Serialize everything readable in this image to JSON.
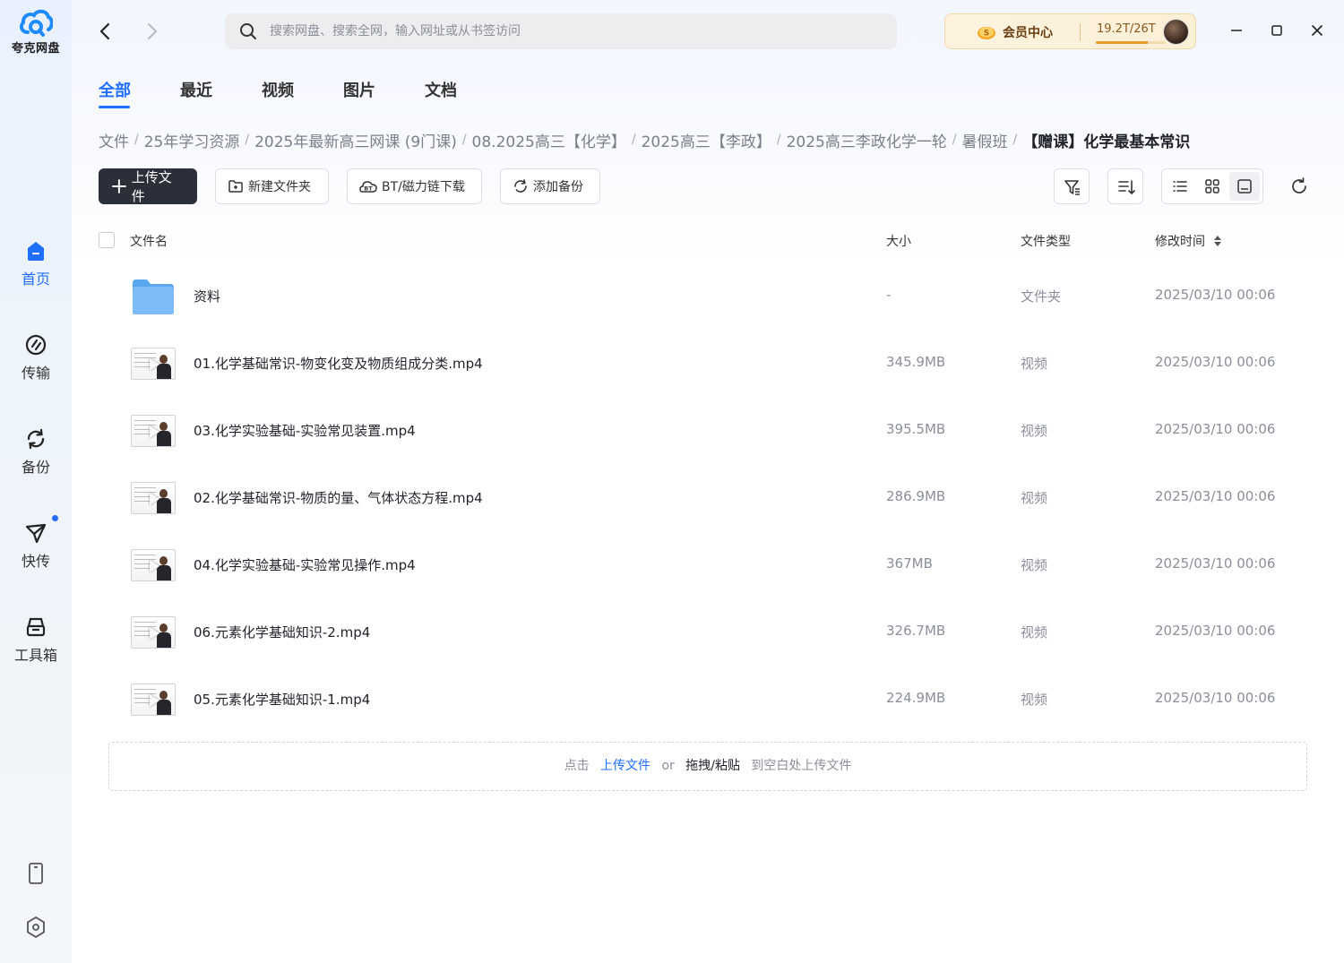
{
  "app": {
    "logo_text": "夸克网盘"
  },
  "sidebar": {
    "items": [
      {
        "label": "首页",
        "icon": "home-icon",
        "active": true
      },
      {
        "label": "传输",
        "icon": "transfer-icon",
        "active": false
      },
      {
        "label": "备份",
        "icon": "backup-icon",
        "active": false
      },
      {
        "label": "快传",
        "icon": "quick-send-icon",
        "active": false,
        "has_dot": true
      },
      {
        "label": "工具箱",
        "icon": "toolbox-icon",
        "active": false
      }
    ],
    "bottom_icons": [
      "phone-icon",
      "settings-icon"
    ]
  },
  "topbar": {
    "search_placeholder": "搜索网盘、搜索全网，输入网址或从书签访问",
    "vip_label": "会员中心",
    "storage_text": "19.2T/26T",
    "storage_used_fraction": 0.738
  },
  "tabs": [
    {
      "label": "全部",
      "active": true
    },
    {
      "label": "最近",
      "active": false
    },
    {
      "label": "视频",
      "active": false
    },
    {
      "label": "图片",
      "active": false
    },
    {
      "label": "文档",
      "active": false
    }
  ],
  "breadcrumb": [
    "文件",
    "25年学习资源",
    "2025年最新高三网课 (9门课)",
    "08.2025高三【化学】",
    "2025高三【李政】",
    "2025高三李政化学一轮",
    "暑假班",
    "【赠课】化学最基本常识"
  ],
  "toolbar": {
    "upload_label": "上传文件",
    "new_folder_label": "新建文件夹",
    "bt_label": "BT/磁力链下载",
    "backup_label": "添加备份"
  },
  "columns": {
    "name": "文件名",
    "size": "大小",
    "type": "文件类型",
    "modified": "修改时间"
  },
  "files": [
    {
      "name": "资料",
      "size": "-",
      "type": "文件夹",
      "modified": "2025/03/10 00:06",
      "kind": "folder"
    },
    {
      "name": "01.化学基础常识-物变化变及物质组成分类.mp4",
      "size": "345.9MB",
      "type": "视频",
      "modified": "2025/03/10 00:06",
      "kind": "video"
    },
    {
      "name": "03.化学实验基础-实验常见装置.mp4",
      "size": "395.5MB",
      "type": "视频",
      "modified": "2025/03/10 00:06",
      "kind": "video"
    },
    {
      "name": "02.化学基础常识-物质的量、气体状态方程.mp4",
      "size": "286.9MB",
      "type": "视频",
      "modified": "2025/03/10 00:06",
      "kind": "video"
    },
    {
      "name": "04.化学实验基础-实验常见操作.mp4",
      "size": "367MB",
      "type": "视频",
      "modified": "2025/03/10 00:06",
      "kind": "video"
    },
    {
      "name": "06.元素化学基础知识-2.mp4",
      "size": "326.7MB",
      "type": "视频",
      "modified": "2025/03/10 00:06",
      "kind": "video"
    },
    {
      "name": "05.元素化学基础知识-1.mp4",
      "size": "224.9MB",
      "type": "视频",
      "modified": "2025/03/10 00:06",
      "kind": "video"
    }
  ],
  "dropzone": {
    "prefix": "点击",
    "upload_link": "上传文件",
    "or": "or",
    "drag_paste": "拖拽/粘贴",
    "suffix": "到空白处上传文件"
  },
  "colors": {
    "accent": "#1f6fff",
    "primary_button": "#2b2f3a",
    "folder": "#5aa7f0"
  }
}
